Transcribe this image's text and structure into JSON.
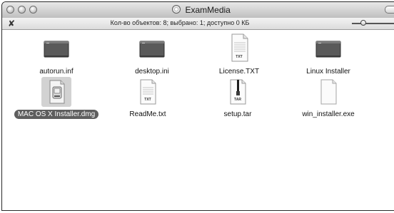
{
  "window": {
    "title": "ExamMedia"
  },
  "statusbar": {
    "text": "Кол-во объектов: 8; выбрано: 1; доступно 0 КБ"
  },
  "files": [
    {
      "name": "autorun.inf",
      "icon": "drive-icon",
      "selected": false
    },
    {
      "name": "desktop.ini",
      "icon": "drive-icon",
      "selected": false
    },
    {
      "name": "License.TXT",
      "icon": "text-document-icon",
      "badge": "TXT",
      "selected": false
    },
    {
      "name": "Linux Installer",
      "icon": "drive-icon",
      "selected": false
    },
    {
      "name": "MAC OS X Installer.dmg",
      "icon": "disk-image-icon",
      "selected": true
    },
    {
      "name": "ReadMe.txt",
      "icon": "text-document-icon",
      "badge": "TXT",
      "selected": false
    },
    {
      "name": "setup.tar",
      "icon": "archive-icon",
      "badge": "TAR",
      "selected": false
    },
    {
      "name": "win_installer.exe",
      "icon": "blank-document-icon",
      "selected": false
    }
  ]
}
